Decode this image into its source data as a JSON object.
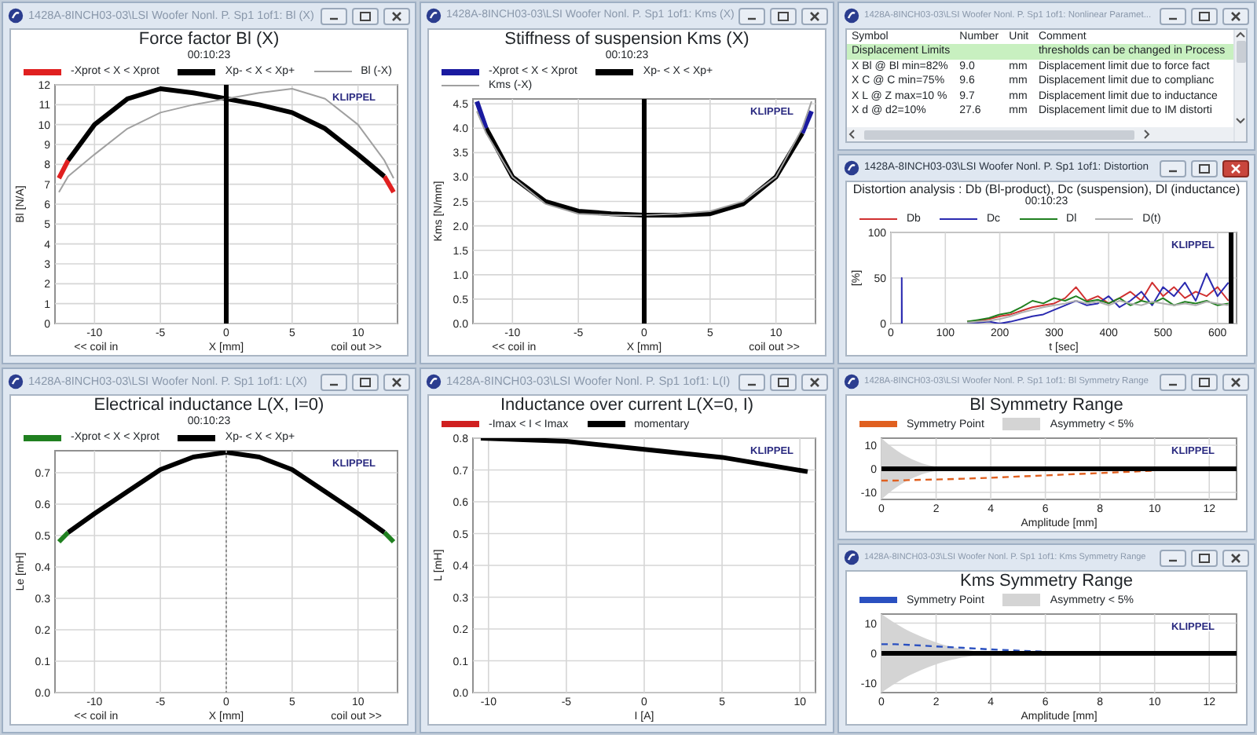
{
  "windows": [
    {
      "title": "1428A-8INCH03-03\\LSI Woofer Nonl. P. Sp1 1of1: Bl (X)",
      "active": false,
      "time": "00:10:23",
      "brand": "KLIPPEL",
      "axis_notes": [
        "<< coil in",
        "coil out >>"
      ],
      "chart_data": {
        "type": "line",
        "title": "Force factor Bl (X)",
        "xlabel": "X [mm]",
        "ylabel": "Bl [N/A]",
        "grid": true,
        "legend": "top",
        "x": [
          -12.7,
          -12,
          -10,
          -7.5,
          -5,
          -2.5,
          0,
          2.5,
          5,
          7.5,
          10,
          12,
          12.7
        ],
        "xlim": [
          -13,
          13
        ],
        "ylim": [
          0,
          12
        ],
        "xticks": [
          -10,
          -5,
          0,
          5,
          10
        ],
        "yticks": [
          0,
          1,
          2,
          3,
          4,
          5,
          6,
          7,
          8,
          9,
          10,
          11,
          12
        ],
        "series": [
          {
            "name": "-Xprot < X < Xprot",
            "color": "#e02020",
            "values": [
              7.3,
              8.2,
              null,
              null,
              null,
              null,
              null,
              null,
              null,
              null,
              null,
              7.4,
              6.6
            ]
          },
          {
            "name": "Xp- < X < Xp+",
            "color": "#000000",
            "values": [
              null,
              8.2,
              10.0,
              11.3,
              11.8,
              11.6,
              11.3,
              11.0,
              10.6,
              9.8,
              8.5,
              7.4,
              null
            ]
          },
          {
            "name": "Bl (-X)",
            "color": "#a0a0a0",
            "values": [
              6.6,
              7.4,
              8.5,
              9.8,
              10.6,
              11.0,
              11.3,
              11.6,
              11.8,
              11.3,
              10.0,
              8.2,
              7.3
            ]
          }
        ],
        "ref_lines": [
          {
            "axis": "x",
            "value": 0,
            "color": "#000000"
          }
        ]
      }
    },
    {
      "title": "1428A-8INCH03-03\\LSI Woofer Nonl. P. Sp1 1of1: Kms (X)",
      "active": false,
      "time": "00:10:23",
      "brand": "KLIPPEL",
      "axis_notes": [
        "<< coil in",
        "coil out >>"
      ],
      "chart_data": {
        "type": "line",
        "title": "Stiffness of suspension Kms (X)",
        "xlabel": "X [mm]",
        "ylabel": "Kms [N/mm]",
        "grid": true,
        "legend": "top",
        "x": [
          -12.7,
          -12,
          -10,
          -7.5,
          -5,
          -2.5,
          0,
          2.5,
          5,
          7.5,
          10,
          12,
          12.7
        ],
        "xlim": [
          -13,
          13
        ],
        "ylim": [
          0,
          4.6
        ],
        "xticks": [
          -10,
          -5,
          0,
          5,
          10
        ],
        "yticks": [
          {
            "value": 0,
            "label": "0.0"
          },
          {
            "value": 0.5,
            "label": "0.5"
          },
          {
            "value": 1,
            "label": "1.0"
          },
          {
            "value": 1.5,
            "label": "1.5"
          },
          {
            "value": 2,
            "label": "2.0"
          },
          {
            "value": 2.5,
            "label": "2.5"
          },
          {
            "value": 3,
            "label": "3.0"
          },
          {
            "value": 3.5,
            "label": "3.5"
          },
          {
            "value": 4,
            "label": "4.0"
          },
          {
            "value": 4.5,
            "label": "4.5"
          }
        ],
        "series": [
          {
            "name": "-Xprot < X < Xprot",
            "color": "#1a1aa0",
            "values": [
              4.55,
              4.0,
              null,
              null,
              null,
              null,
              null,
              null,
              null,
              null,
              null,
              3.9,
              4.35
            ]
          },
          {
            "name": "Xp- < X < Xp+",
            "color": "#000000",
            "values": [
              null,
              4.0,
              3.0,
              2.5,
              2.3,
              2.25,
              2.22,
              2.22,
              2.25,
              2.45,
              3.0,
              3.9,
              null
            ]
          },
          {
            "name": "Kms (-X)",
            "color": "#a0a0a0",
            "values": [
              4.35,
              3.9,
              3.0,
              2.45,
              2.25,
              2.22,
              2.22,
              2.25,
              2.3,
              2.5,
              3.0,
              4.0,
              4.55
            ]
          }
        ],
        "ref_lines": [
          {
            "axis": "x",
            "value": 0,
            "color": "#000000"
          }
        ]
      }
    },
    {
      "title": "1428A-8INCH03-03\\LSI Woofer Nonl. P. Sp1 1of1: Nonlinear Paramet...",
      "active": false,
      "table": {
        "columns": [
          "Symbol",
          "Number",
          "Unit",
          "Comment"
        ],
        "rows": [
          {
            "kind": "group",
            "cells": [
              {
                "text": "Displacement Limits",
                "colspan": 3
              },
              {
                "text": "thresholds can be changed in Process"
              }
            ]
          },
          {
            "kind": "item",
            "cells": [
              "X Bl @ Bl min=82%",
              "9.0",
              "mm",
              "Displacement limit due to force fact"
            ]
          },
          {
            "kind": "item",
            "cells": [
              "X C @ C min=75%",
              "9.6",
              "mm",
              "Displacement limit due to complianc"
            ]
          },
          {
            "kind": "item",
            "cells": [
              "X L @ Z max=10 %",
              "9.7",
              "mm",
              "Displacement limit due to inductance"
            ]
          },
          {
            "kind": "item",
            "cells": [
              "X d @ d2=10%",
              "27.6",
              "mm",
              "Displacement limit due to IM distorti"
            ]
          }
        ]
      }
    },
    {
      "title": "1428A-8INCH03-03\\LSI Woofer Nonl. P. Sp1 1of1: Distortion",
      "active": true,
      "time": "00:10:23",
      "brand": "KLIPPEL",
      "chart_data": {
        "type": "line",
        "title": "Distortion analysis : Db (Bl-product), Dc (suspension), Dl (inductance)",
        "xlabel": "t [sec]",
        "ylabel": "[%]",
        "grid": true,
        "legend": "top",
        "x": [
          19.9,
          20,
          20.1,
          130,
          140,
          160,
          180,
          200,
          220,
          240,
          260,
          280,
          300,
          320,
          340,
          360,
          380,
          400,
          420,
          440,
          460,
          480,
          500,
          520,
          540,
          560,
          580,
          600,
          620
        ],
        "xlim": [
          0,
          635
        ],
        "ylim": [
          0,
          100
        ],
        "xticks": [
          0,
          100,
          200,
          300,
          400,
          500,
          600
        ],
        "yticks": [
          0,
          50,
          100
        ],
        "series": [
          {
            "name": "Db",
            "color": "#d03030",
            "values": [
              null,
              null,
              null,
              null,
              2,
              3,
              5,
              8,
              10,
              14,
              18,
              20,
              22,
              28,
              40,
              25,
              30,
              22,
              28,
              35,
              25,
              45,
              30,
              40,
              28,
              35,
              30,
              40,
              25
            ]
          },
          {
            "name": "Dc",
            "color": "#2a2ab0",
            "values": [
              0,
              50,
              0,
              null,
              1,
              1,
              2,
              0,
              2,
              5,
              8,
              10,
              15,
              20,
              25,
              20,
              22,
              30,
              18,
              25,
              35,
              20,
              40,
              30,
              45,
              25,
              55,
              30,
              45
            ]
          },
          {
            "name": "Dl",
            "color": "#208020",
            "values": [
              null,
              null,
              null,
              null,
              2,
              4,
              6,
              10,
              12,
              18,
              25,
              22,
              28,
              25,
              30,
              24,
              26,
              22,
              28,
              20,
              25,
              22,
              28,
              20,
              24,
              22,
              25,
              20,
              22
            ]
          },
          {
            "name": "D(t)",
            "color": "#b0b0b0",
            "values": [
              null,
              null,
              null,
              null,
              1,
              2,
              3,
              5,
              8,
              12,
              15,
              18,
              20,
              22,
              25,
              22,
              24,
              20,
              25,
              22,
              20,
              24,
              22,
              20,
              22,
              20,
              24,
              22,
              20
            ]
          }
        ],
        "ref_lines": [
          {
            "axis": "x",
            "value": 625,
            "color": "#000000"
          }
        ]
      }
    },
    {
      "title": "1428A-8INCH03-03\\LSI Woofer Nonl. P. Sp1 1of1: L(X)",
      "active": false,
      "time": "00:10:23",
      "brand": "KLIPPEL",
      "axis_notes": [
        "<< coil in",
        "coil out >>"
      ],
      "chart_data": {
        "type": "line",
        "title": "Electrical inductance L(X, I=0)",
        "xlabel": "X [mm]",
        "ylabel": "Le [mH]",
        "grid": true,
        "legend": "top",
        "x": [
          -12.7,
          -12,
          -10,
          -7.5,
          -5,
          -2.5,
          0,
          2.5,
          5,
          7.5,
          10,
          12,
          12.7
        ],
        "xlim": [
          -13,
          13
        ],
        "ylim": [
          0,
          0.77
        ],
        "xticks": [
          -10,
          -5,
          0,
          5,
          10
        ],
        "yticks": [
          {
            "value": 0,
            "label": "0.0"
          },
          {
            "value": 0.1,
            "label": "0.1"
          },
          {
            "value": 0.2,
            "label": "0.2"
          },
          {
            "value": 0.3,
            "label": "0.3"
          },
          {
            "value": 0.4,
            "label": "0.4"
          },
          {
            "value": 0.5,
            "label": "0.5"
          },
          {
            "value": 0.6,
            "label": "0.6"
          },
          {
            "value": 0.7,
            "label": "0.7"
          }
        ],
        "series": [
          {
            "name": "-Xprot < X < Xprot",
            "color": "#208020",
            "values": [
              0.48,
              0.51,
              null,
              null,
              null,
              null,
              null,
              null,
              null,
              null,
              null,
              0.51,
              0.48
            ]
          },
          {
            "name": "Xp- < X < Xp+",
            "color": "#000000",
            "values": [
              null,
              0.51,
              0.57,
              0.64,
              0.71,
              0.75,
              0.765,
              0.75,
              0.71,
              0.64,
              0.57,
              0.51,
              null
            ]
          }
        ],
        "ref_lines": [
          {
            "axis": "x",
            "value": 0,
            "color": "#909090"
          }
        ]
      }
    },
    {
      "title": "1428A-8INCH03-03\\LSI Woofer Nonl. P. Sp1 1of1: L(I)",
      "active": false,
      "brand": "KLIPPEL",
      "chart_data": {
        "type": "line",
        "title": "Inductance over current L(X=0, I)",
        "xlabel": "I [A]",
        "ylabel": "L [mH]",
        "grid": true,
        "legend": "top",
        "x": [
          -10.5,
          -5,
          0,
          5,
          10.5
        ],
        "xlim": [
          -11,
          11
        ],
        "ylim": [
          0,
          0.8
        ],
        "xticks": [
          -10,
          -5,
          0,
          5,
          10
        ],
        "yticks": [
          {
            "value": 0,
            "label": "0.0"
          },
          {
            "value": 0.1,
            "label": "0.1"
          },
          {
            "value": 0.2,
            "label": "0.2"
          },
          {
            "value": 0.3,
            "label": "0.3"
          },
          {
            "value": 0.4,
            "label": "0.4"
          },
          {
            "value": 0.5,
            "label": "0.5"
          },
          {
            "value": 0.6,
            "label": "0.6"
          },
          {
            "value": 0.7,
            "label": "0.7"
          },
          {
            "value": 0.8,
            "label": "0.8"
          }
        ],
        "series": [
          {
            "name": "-Imax < I < Imax",
            "color": "#d02020",
            "values": [
              null,
              null,
              null,
              null,
              null
            ]
          },
          {
            "name": "momentary",
            "color": "#000000",
            "values": [
              0.8,
              0.79,
              0.765,
              0.74,
              0.695
            ]
          }
        ]
      }
    },
    {
      "title": "1428A-8INCH03-03\\LSI Woofer Nonl. P. Sp1 1of1: Bl Symmetry Range",
      "active": false,
      "brand": "KLIPPEL",
      "shading": {
        "label": "Asymmetry < 5%",
        "color": "#d4d4d4"
      },
      "chart_data": {
        "type": "line",
        "title": "Bl Symmetry Range",
        "xlabel": "Amplitude [mm]",
        "grid": true,
        "legend": "top",
        "x": [
          0,
          0.5,
          1,
          2,
          3,
          4,
          6,
          8,
          10
        ],
        "xlim": [
          0,
          13
        ],
        "ylim": [
          -13,
          13
        ],
        "xticks": [
          0,
          2,
          4,
          6,
          8,
          10,
          12
        ],
        "yticks": [
          -10,
          0,
          10
        ],
        "series": [
          {
            "name": "Symmetry Point",
            "color": "#e06020",
            "line_style": "dashed",
            "values": [
              -5,
              -5,
              -4.8,
              -4.5,
              -4.2,
              -3.8,
              -2.8,
              -1.8,
              -0.8
            ]
          }
        ],
        "ref_lines": [
          {
            "axis": "y",
            "value": 0,
            "color": "#000000"
          }
        ]
      }
    },
    {
      "title": "1428A-8INCH03-03\\LSI Woofer Nonl. P. Sp1 1of1: Kms Symmetry Range",
      "active": false,
      "brand": "KLIPPEL",
      "shading": {
        "label": "Asymmetry < 5%",
        "color": "#d4d4d4"
      },
      "chart_data": {
        "type": "line",
        "title": "Kms Symmetry Range",
        "xlabel": "Amplitude [mm]",
        "grid": true,
        "legend": "top",
        "x": [
          0,
          0.5,
          1,
          2,
          3,
          4,
          6
        ],
        "xlim": [
          0,
          13
        ],
        "ylim": [
          -13,
          13
        ],
        "xticks": [
          0,
          2,
          4,
          6,
          8,
          10,
          12
        ],
        "yticks": [
          -10,
          0,
          10
        ],
        "series": [
          {
            "name": "Symmetry Point",
            "color": "#2a50c0",
            "line_style": "dashed",
            "values": [
              3,
              3,
              2.8,
              2.3,
              1.8,
              1.3,
              0.5
            ]
          }
        ],
        "ref_lines": [
          {
            "axis": "y",
            "value": 0,
            "color": "#000000"
          }
        ]
      }
    }
  ]
}
